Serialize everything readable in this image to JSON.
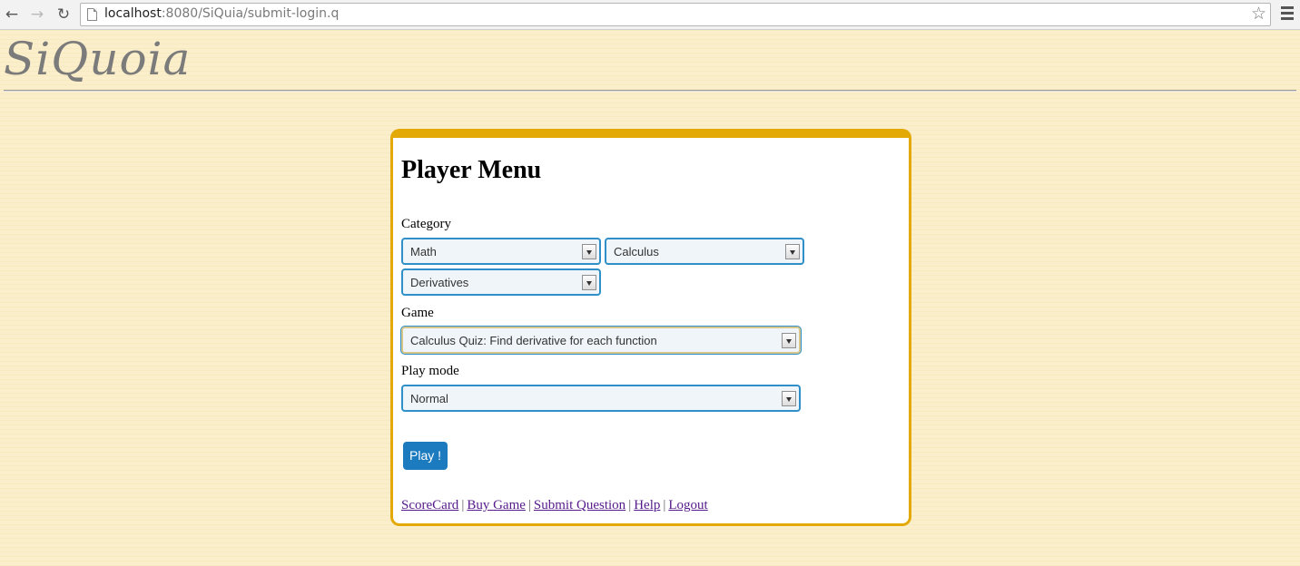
{
  "browser": {
    "url_host": "localhost",
    "url_rest": ":8080/SiQuia/submit-login.q"
  },
  "logo": {
    "text": "SiQuoia"
  },
  "panel": {
    "title": "Player Menu",
    "category": {
      "label": "Category",
      "select1_value": "Math",
      "select2_value": "Calculus",
      "select3_value": "Derivatives"
    },
    "game": {
      "label": "Game",
      "value": "Calculus Quiz: Find derivative for each function"
    },
    "play_mode": {
      "label": "Play mode",
      "value": "Normal"
    },
    "play_button": "Play !",
    "links": [
      {
        "label": "ScoreCard"
      },
      {
        "label": "Buy Game"
      },
      {
        "label": "Submit Question"
      },
      {
        "label": "Help"
      },
      {
        "label": "Logout"
      }
    ],
    "separator": "|"
  },
  "colors": {
    "page_background": "#fbefcb",
    "panel_border": "#e3aa07",
    "select_border": "#2f8fc8",
    "button_background": "#1c7bbf",
    "link_visited": "#551a8b"
  },
  "icons": [
    "back-icon",
    "forward-icon",
    "reload-icon",
    "page-icon",
    "star-icon",
    "menu-icon",
    "chevron-down-icon"
  ]
}
